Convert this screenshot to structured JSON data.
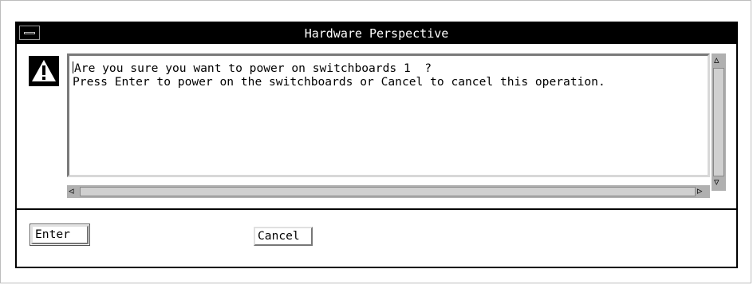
{
  "window": {
    "title": "Hardware Perspective"
  },
  "message": {
    "line1": "Are you sure you want to power on switchboards 1  ?",
    "line2": "Press Enter to power on the switchboards or Cancel to cancel this operation."
  },
  "icons": {
    "warning": "warning-icon",
    "window_menu": "window-menu-icon"
  },
  "buttons": {
    "enter_label": "Enter",
    "cancel_label": "Cancel"
  }
}
